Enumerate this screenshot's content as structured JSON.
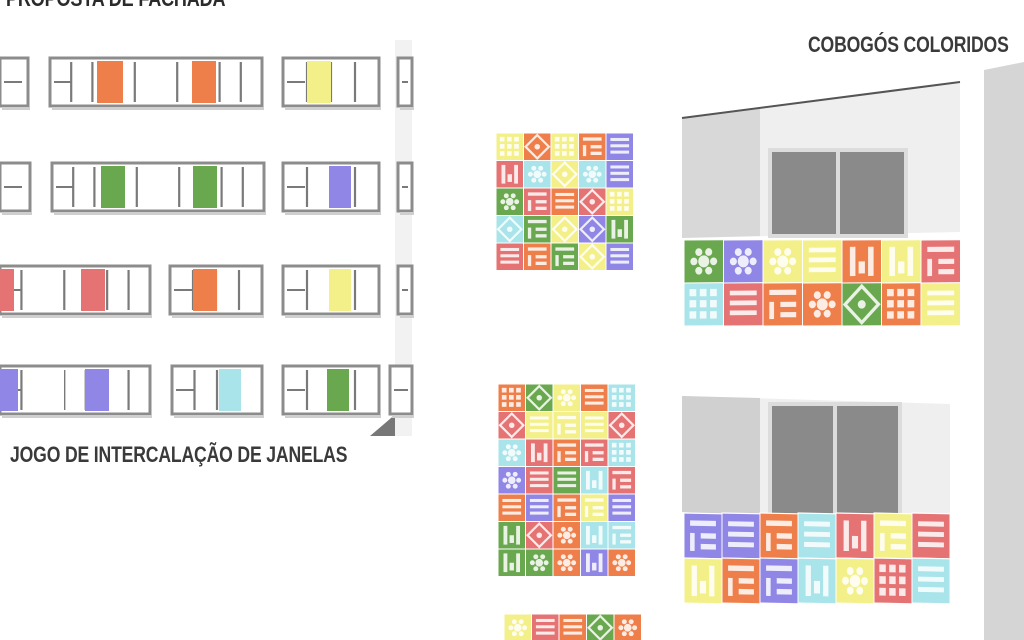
{
  "header": {
    "title_partial": "PROPOSTA DE FACHADA"
  },
  "labels": {
    "cobogos": "COBOGÓS COLORIDOS",
    "janelas": "JOGO DE INTERCALAÇÃO DE JANELAS"
  },
  "palette": {
    "orange": "#ef7f4a",
    "white": "#ffffff",
    "yellow": "#f3f08a",
    "green": "#6aa84f",
    "lavender": "#8f86e6",
    "red": "#e57373",
    "cyan": "#a8e4ea",
    "frame": "#8c8c8c",
    "wall": "#ffffff",
    "shadow": "#d9d9d9",
    "dark_shadow": "#b8b8b8"
  },
  "window_rows": [
    [
      "orange",
      "white",
      "orange",
      "yellow"
    ],
    [
      "green",
      "white",
      "green",
      "lavender"
    ],
    [
      "red",
      "white",
      "red",
      "orange",
      "yellow"
    ],
    [
      "lavender",
      "white",
      "lavender",
      "cyan",
      "green"
    ]
  ],
  "cobogo_colors": [
    "orange",
    "green",
    "red",
    "yellow",
    "lavender",
    "cyan",
    "orange",
    "red"
  ]
}
